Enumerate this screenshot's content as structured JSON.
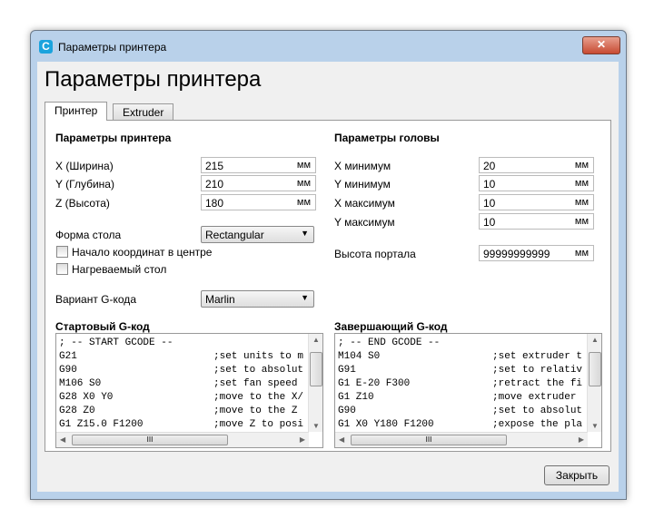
{
  "window": {
    "title": "Параметры принтера",
    "app_icon": "C",
    "heading": "Параметры принтера"
  },
  "tabs": [
    {
      "label": "Принтер",
      "active": true
    },
    {
      "label": "Extruder",
      "active": false
    }
  ],
  "printer": {
    "section": "Параметры принтера",
    "x": {
      "label": "X (Ширина)",
      "value": "215",
      "unit": "мм"
    },
    "y": {
      "label": "Y (Глубина)",
      "value": "210",
      "unit": "мм"
    },
    "z": {
      "label": "Z (Высота)",
      "value": "180",
      "unit": "мм"
    },
    "bed_shape": {
      "label": "Форма стола",
      "value": "Rectangular"
    },
    "center_origin": {
      "label": "Начало координат в центре",
      "checked": false
    },
    "heated_bed": {
      "label": "Нагреваемый стол",
      "checked": false
    },
    "gcode_flavor": {
      "label": "Вариант G-кода",
      "value": "Marlin"
    }
  },
  "head": {
    "section": "Параметры головы",
    "x_min": {
      "label": "X минимум",
      "value": "20",
      "unit": "мм"
    },
    "y_min": {
      "label": "Y минимум",
      "value": "10",
      "unit": "мм"
    },
    "x_max": {
      "label": "X максимум",
      "value": "10",
      "unit": "мм"
    },
    "y_max": {
      "label": "Y максимум",
      "value": "10",
      "unit": "мм"
    },
    "gantry": {
      "label": "Высота портала",
      "value": "99999999999",
      "unit": "мм"
    }
  },
  "start_gcode": {
    "label": "Стартовый G-код",
    "lines": [
      {
        "cmd": "; -- START GCODE --",
        "comment": ""
      },
      {
        "cmd": "G21",
        "comment": ";set units to m"
      },
      {
        "cmd": "G90",
        "comment": ";set to absolut"
      },
      {
        "cmd": "M106 S0",
        "comment": ";set fan speed"
      },
      {
        "cmd": "G28 X0 Y0",
        "comment": ";move to the X/"
      },
      {
        "cmd": "G28 Z0",
        "comment": ";move to the Z"
      },
      {
        "cmd": "G1 Z15.0 F1200",
        "comment": ";move Z to posi"
      }
    ]
  },
  "end_gcode": {
    "label": "Завершающий G-код",
    "lines": [
      {
        "cmd": "; -- END GCODE --",
        "comment": ""
      },
      {
        "cmd": "M104 S0",
        "comment": ";set extruder t"
      },
      {
        "cmd": "G91",
        "comment": ";set to relativ"
      },
      {
        "cmd": "G1 E-20 F300",
        "comment": ";retract the fi"
      },
      {
        "cmd": "G1 Z10",
        "comment": ";move extruder"
      },
      {
        "cmd": "G90",
        "comment": ";set to absolut"
      },
      {
        "cmd": "G1 X0 Y180 F1200",
        "comment": ";expose the pla"
      }
    ]
  },
  "close_button": "Закрыть"
}
